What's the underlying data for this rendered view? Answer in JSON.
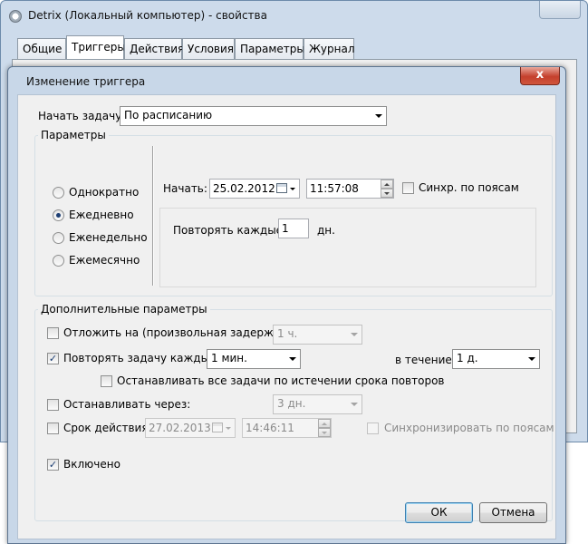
{
  "back_window": {
    "title": "Detrix (Локальный компьютер) - свойства",
    "tabs": [
      "Общие",
      "Триггеры",
      "Действия",
      "Условия",
      "Параметры",
      "Журнал"
    ],
    "active_tab": "Триггеры"
  },
  "dialog": {
    "title": "Изменение триггера",
    "close_glyph": "x",
    "begin_task_label": "Начать задачу:",
    "begin_task_value": "По расписанию",
    "settings_group_title": "Параметры",
    "schedule_options": [
      "Однократно",
      "Ежедневно",
      "Еженедельно",
      "Ежемесячно"
    ],
    "selected_schedule": "Ежедневно",
    "start_label": "Начать:",
    "start_date": "25.02.2012",
    "start_time": "11:57:08",
    "sync_timezones_label": "Синхр. по поясам",
    "repeat_every_label": "Повторять каждые:",
    "repeat_every_value": "1",
    "repeat_every_unit": "дн.",
    "advanced_group_title": "Дополнительные параметры",
    "delay_label": "Отложить на (произвольная задержка):",
    "delay_value": "1 ч.",
    "repeat_task_label": "Повторять задачу каждые:",
    "repeat_task_value": "1 мин.",
    "duration_label": "в течение:",
    "duration_value": "1 д.",
    "stop_all_label": "Останавливать все задачи по истечении срока повторов",
    "stop_after_label": "Останавливать через:",
    "stop_after_value": "3 дн.",
    "expire_label": "Срок действия:",
    "expire_date": "27.02.2013",
    "expire_time": "14:46:11",
    "expire_sync_label": "Синхронизировать по поясам",
    "enabled_label": "Включено",
    "ok_label": "ОК",
    "cancel_label": "Отмена",
    "checkbox_mark": "✓",
    "checks": {
      "delay": false,
      "repeat_task": true,
      "stop_all": false,
      "stop_after": false,
      "expire": false,
      "expire_sync": false,
      "enabled": true,
      "sync_timezones": false
    }
  }
}
